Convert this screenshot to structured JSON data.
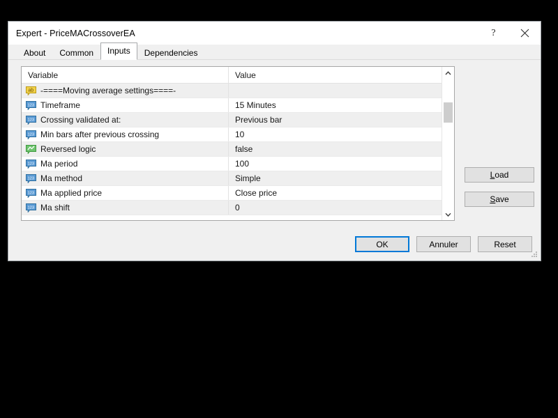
{
  "window": {
    "title": "Expert - PriceMACrossoverEA",
    "help_glyph": "?",
    "close_glyph": "✕"
  },
  "tabs": [
    {
      "label": "About",
      "selected": false
    },
    {
      "label": "Common",
      "selected": false
    },
    {
      "label": "Inputs",
      "selected": true
    },
    {
      "label": "Dependencies",
      "selected": false
    }
  ],
  "grid": {
    "columns": {
      "variable": "Variable",
      "value": "Value"
    },
    "rows": [
      {
        "icon": "string-type-icon",
        "variable": "-====Moving average settings====-",
        "value": ""
      },
      {
        "icon": "number-type-icon",
        "variable": "Timeframe",
        "value": "15 Minutes"
      },
      {
        "icon": "number-type-icon",
        "variable": "Crossing validated at:",
        "value": "Previous bar"
      },
      {
        "icon": "number-type-icon",
        "variable": "Min bars after previous crossing",
        "value": "10"
      },
      {
        "icon": "boolean-type-icon",
        "variable": "Reversed logic",
        "value": "false"
      },
      {
        "icon": "number-type-icon",
        "variable": "Ma period",
        "value": "100"
      },
      {
        "icon": "number-type-icon",
        "variable": "Ma method",
        "value": "Simple"
      },
      {
        "icon": "number-type-icon",
        "variable": "Ma applied price",
        "value": "Close price"
      },
      {
        "icon": "number-type-icon",
        "variable": "Ma shift",
        "value": "0"
      }
    ]
  },
  "side_buttons": {
    "load": {
      "mnemonic": "L",
      "rest": "oad"
    },
    "save": {
      "mnemonic": "S",
      "rest": "ave"
    }
  },
  "bottom_buttons": {
    "ok": "OK",
    "cancel": "Annuler",
    "reset": "Reset"
  },
  "colors": {
    "accent": "#0078d7",
    "dialog_bg": "#f0f0f0",
    "row_alt": "#efefef",
    "string_icon": "#f2d14a",
    "number_icon": "#5b9bd5",
    "boolean_icon": "#6fc46f"
  }
}
